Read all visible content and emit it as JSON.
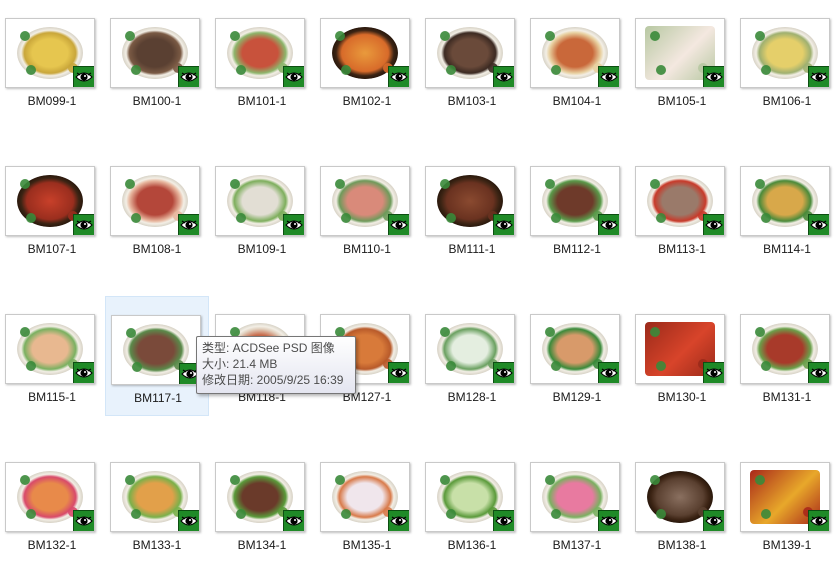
{
  "files": [
    {
      "name": "BM099-1",
      "style": "plate",
      "c1": "#e6c64f",
      "c2": "#c9a63a"
    },
    {
      "name": "BM100-1",
      "style": "plate",
      "c1": "#5a4032",
      "c2": "#7a5a44"
    },
    {
      "name": "BM101-1",
      "style": "plate",
      "c1": "#c8523c",
      "c2": "#8db56b"
    },
    {
      "name": "BM102-1",
      "style": "pot",
      "c1": "#e99a3c",
      "c2": "#d86b2a"
    },
    {
      "name": "BM103-1",
      "style": "plate",
      "c1": "#6a4a3a",
      "c2": "#3c2a22"
    },
    {
      "name": "BM104-1",
      "style": "plate",
      "c1": "#c9683a",
      "c2": "#e8d0a0"
    },
    {
      "name": "BM105-1",
      "style": "square",
      "c1": "#f4e8e0",
      "c2": "#b7c8a2"
    },
    {
      "name": "BM106-1",
      "style": "plate",
      "c1": "#e5cf6a",
      "c2": "#9fb070"
    },
    {
      "name": "BM107-1",
      "style": "pot",
      "c1": "#c8402a",
      "c2": "#9a2e1e"
    },
    {
      "name": "BM108-1",
      "style": "plate",
      "c1": "#b4473a",
      "c2": "#e8b8a0"
    },
    {
      "name": "BM109-1",
      "style": "plate",
      "c1": "#e2ded4",
      "c2": "#7dae5c"
    },
    {
      "name": "BM110-1",
      "style": "plate",
      "c1": "#d98a7a",
      "c2": "#6e9a5a"
    },
    {
      "name": "BM111-1",
      "style": "pot",
      "c1": "#8a4a30",
      "c2": "#6a3220"
    },
    {
      "name": "BM112-1",
      "style": "plate",
      "c1": "#6e3a2a",
      "c2": "#5a9a4a"
    },
    {
      "name": "BM113-1",
      "style": "plate",
      "c1": "#9a7a6a",
      "c2": "#c83a2a"
    },
    {
      "name": "BM114-1",
      "style": "plate",
      "c1": "#d8a84a",
      "c2": "#4a8a3a"
    },
    {
      "name": "BM115-1",
      "style": "plate",
      "c1": "#e8b890",
      "c2": "#7ab060"
    },
    {
      "name": "BM117-1",
      "style": "plate",
      "c1": "#7a4a3a",
      "c2": "#5a8a4a"
    },
    {
      "name": "BM118-1",
      "style": "plate",
      "c1": "#c86a4a",
      "c2": "#e2d2c0"
    },
    {
      "name": "BM127-1",
      "style": "plate",
      "c1": "#d87a3a",
      "c2": "#b85a2a"
    },
    {
      "name": "BM128-1",
      "style": "plate",
      "c1": "#e4eee0",
      "c2": "#6aa060"
    },
    {
      "name": "BM129-1",
      "style": "plate",
      "c1": "#d89a6a",
      "c2": "#3a8a3a"
    },
    {
      "name": "BM130-1",
      "style": "square",
      "c1": "#d8442a",
      "c2": "#9a2a1a"
    },
    {
      "name": "BM131-1",
      "style": "plate",
      "c1": "#a83a2a",
      "c2": "#6aa04a"
    },
    {
      "name": "BM132-1",
      "style": "plate",
      "c1": "#e88a4a",
      "c2": "#d84a6a"
    },
    {
      "name": "BM133-1",
      "style": "plate",
      "c1": "#e2a04a",
      "c2": "#7ab04a"
    },
    {
      "name": "BM134-1",
      "style": "plate",
      "c1": "#6a3a2a",
      "c2": "#5a9a3a"
    },
    {
      "name": "BM135-1",
      "style": "plate",
      "c1": "#f0e6ec",
      "c2": "#d87a4a"
    },
    {
      "name": "BM136-1",
      "style": "plate",
      "c1": "#c8e0a8",
      "c2": "#5a9a3a"
    },
    {
      "name": "BM137-1",
      "style": "plate",
      "c1": "#e87aa0",
      "c2": "#7ab060"
    },
    {
      "name": "BM138-1",
      "style": "pot",
      "c1": "#8a7060",
      "c2": "#5a4030"
    },
    {
      "name": "BM139-1",
      "style": "square",
      "c1": "#e8a82a",
      "c2": "#a8281a"
    }
  ],
  "selected_index": 17,
  "overlay_icon": "green-eye-icon",
  "tooltip": {
    "type_line": "类型: ACDSee PSD 图像",
    "size_line": "大小: 21.4 MB",
    "date_line": "修改日期: 2005/9/25 16:39"
  }
}
